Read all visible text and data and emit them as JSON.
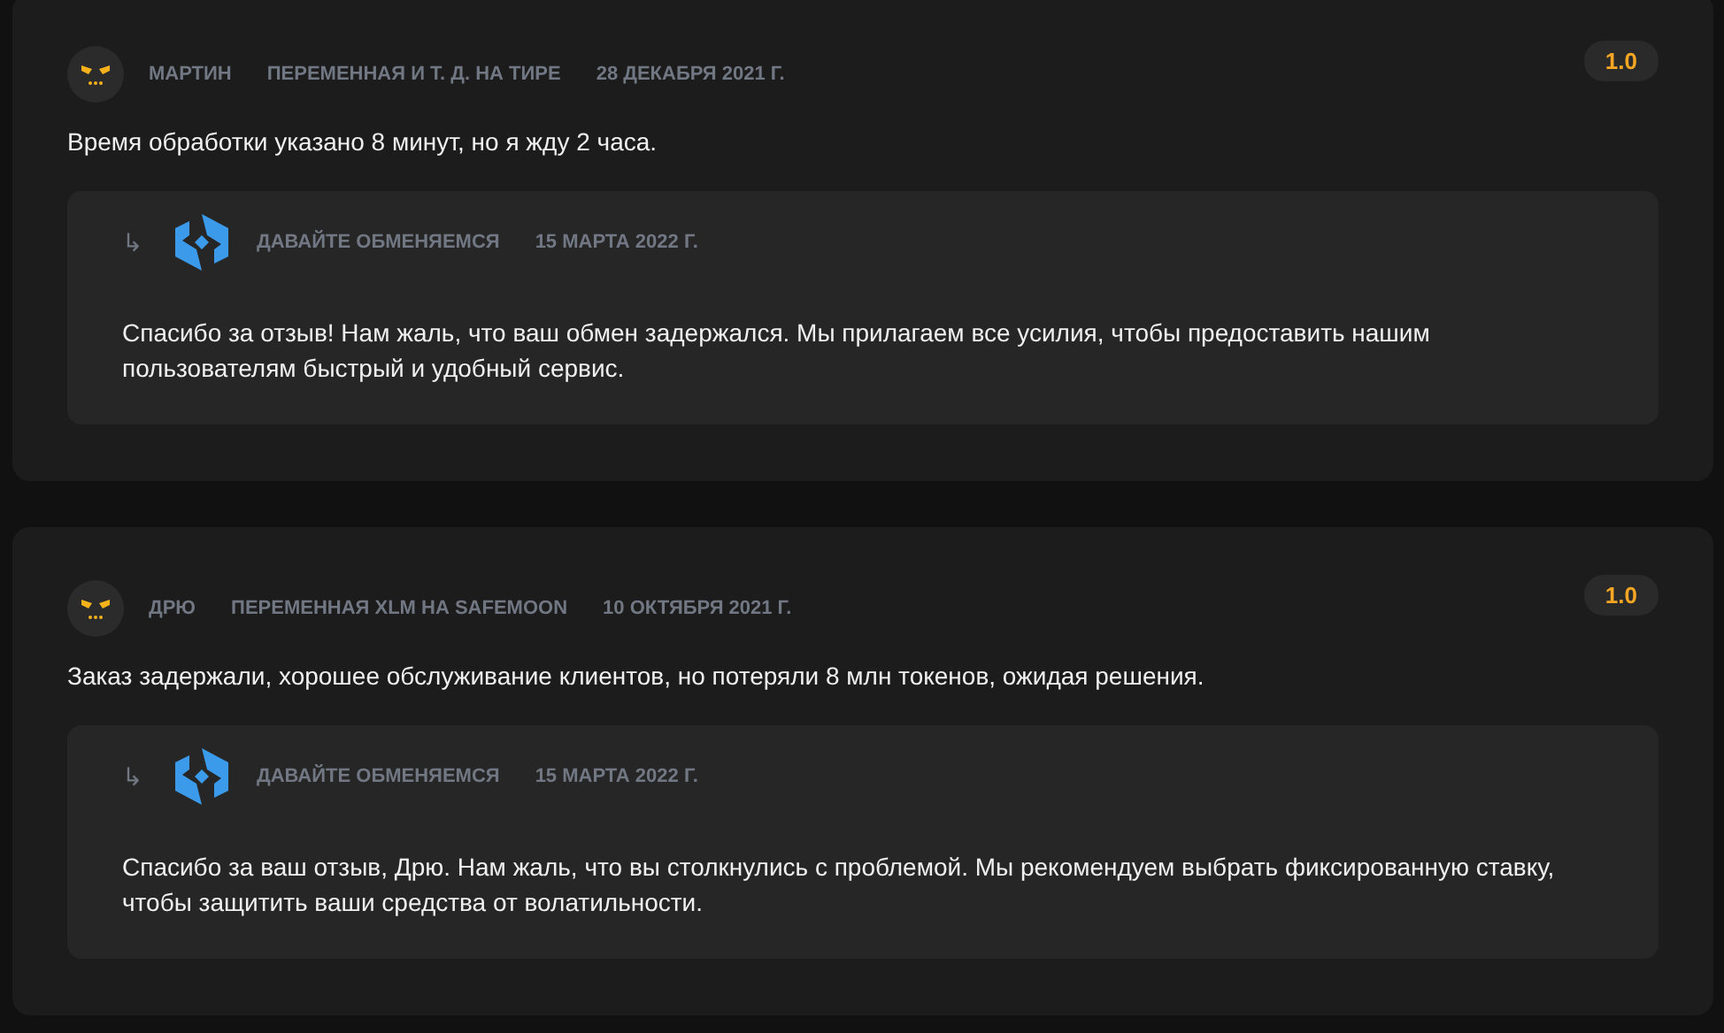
{
  "reviews": [
    {
      "author": "МАРТИН",
      "exchange": "ПЕРЕМЕННАЯ И Т. Д. НА ТИРЕ",
      "date": "28 ДЕКАБРЯ 2021 Г.",
      "rating": "1.0",
      "text": "Время обработки указано 8 минут, но я жду 2 часа.",
      "reply": {
        "arrow": "↳",
        "author": "ДАВАЙТЕ ОБМЕНЯЕМСЯ",
        "date": "15 МАРТА 2022 Г.",
        "text": "Спасибо за отзыв! Нам жаль, что ваш обмен задержался. Мы прилагаем все усилия, чтобы предоставить нашим пользователям быстрый и удобный сервис."
      }
    },
    {
      "author": "ДРЮ",
      "exchange": "ПЕРЕМЕННАЯ XLM НА SAFEMOON",
      "date": "10 ОКТЯБРЯ 2021 Г.",
      "rating": "1.0",
      "text": "Заказ задержали, хорошее обслуживание клиентов, но потеряли 8 млн токенов, ожидая решения.",
      "reply": {
        "arrow": "↳",
        "author": "ДАВАЙТЕ ОБМЕНЯЕМСЯ",
        "date": "15 МАРТА 2022 Г.",
        "text": "Спасибо за ваш отзыв, Дрю. Нам жаль, что вы столкнулись с проблемой. Мы рекомендуем выбрать фиксированную ставку, чтобы защитить ваши средства от волатильности."
      }
    }
  ]
}
